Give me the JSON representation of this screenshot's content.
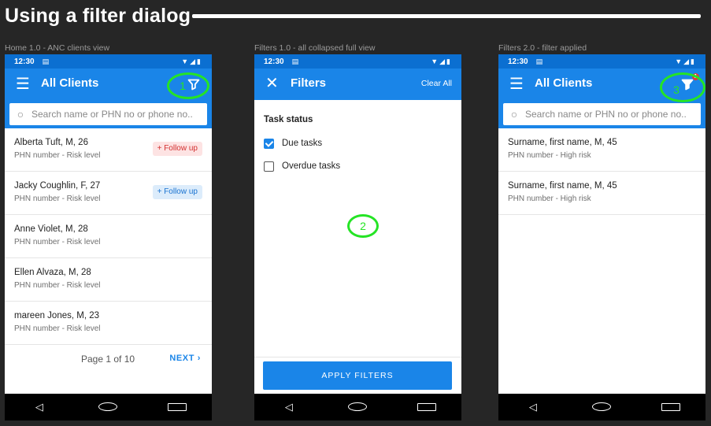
{
  "page": {
    "title": "Using a filter dialog"
  },
  "screens": [
    {
      "caption": "Home 1.0 - ANC clients view",
      "status": {
        "time": "12:30"
      },
      "app_bar": {
        "title": "All Clients"
      },
      "search": {
        "placeholder": "Search name or PHN no or phone no.."
      },
      "marker": "1",
      "rows": [
        {
          "name": "Alberta Tuft, M, 26",
          "sub": "PHN number - Risk level",
          "badge": "+ Follow up",
          "badge_color": "#d32f2f"
        },
        {
          "name": "Jacky Coughlin, F, 27",
          "sub": "PHN number - Risk level",
          "badge": "+ Follow up",
          "badge_color": "#1a73d1"
        },
        {
          "name": "Anne Violet, M, 28",
          "sub": "PHN number - Risk level"
        },
        {
          "name": "Ellen Alvaza, M, 28",
          "sub": "PHN number - Risk level"
        },
        {
          "name": "mareen Jones, M, 23",
          "sub": "PHN number - Risk level"
        }
      ],
      "pager": {
        "label": "Page 1 of 10",
        "next": "NEXT"
      }
    },
    {
      "caption": "Filters 1.0 - all collapsed full view",
      "status": {
        "time": "12:30"
      },
      "app_bar": {
        "title": "Filters",
        "clear_all": "Clear All"
      },
      "section": "Task status",
      "options": [
        {
          "label": "Due tasks",
          "checked": true
        },
        {
          "label": "Overdue tasks",
          "checked": false
        }
      ],
      "marker": "2",
      "apply": "APPLY FILTERS"
    },
    {
      "caption": "Filters 2.0 - filter applied",
      "status": {
        "time": "12:30"
      },
      "app_bar": {
        "title": "All Clients"
      },
      "search": {
        "placeholder": "Search name or PHN no or phone no.."
      },
      "marker": "3",
      "notification_count": "1",
      "rows": [
        {
          "name": "Surname, first name, M, 45",
          "sub": "PHN number - High risk"
        },
        {
          "name": "Surname, first name, M, 45",
          "sub": "PHN number - High risk"
        }
      ]
    }
  ],
  "colors": {
    "app_bar": "#1a85e8",
    "status_bar": "#0b6fd1",
    "marker": "#25e425",
    "background": "#262626"
  },
  "icons": {
    "menu": "menu-icon",
    "filter": "filter-icon",
    "search": "search-icon",
    "close": "close-icon",
    "next": "chevron-right-icon",
    "nav": [
      "back-icon",
      "home-icon",
      "recents-icon"
    ]
  }
}
